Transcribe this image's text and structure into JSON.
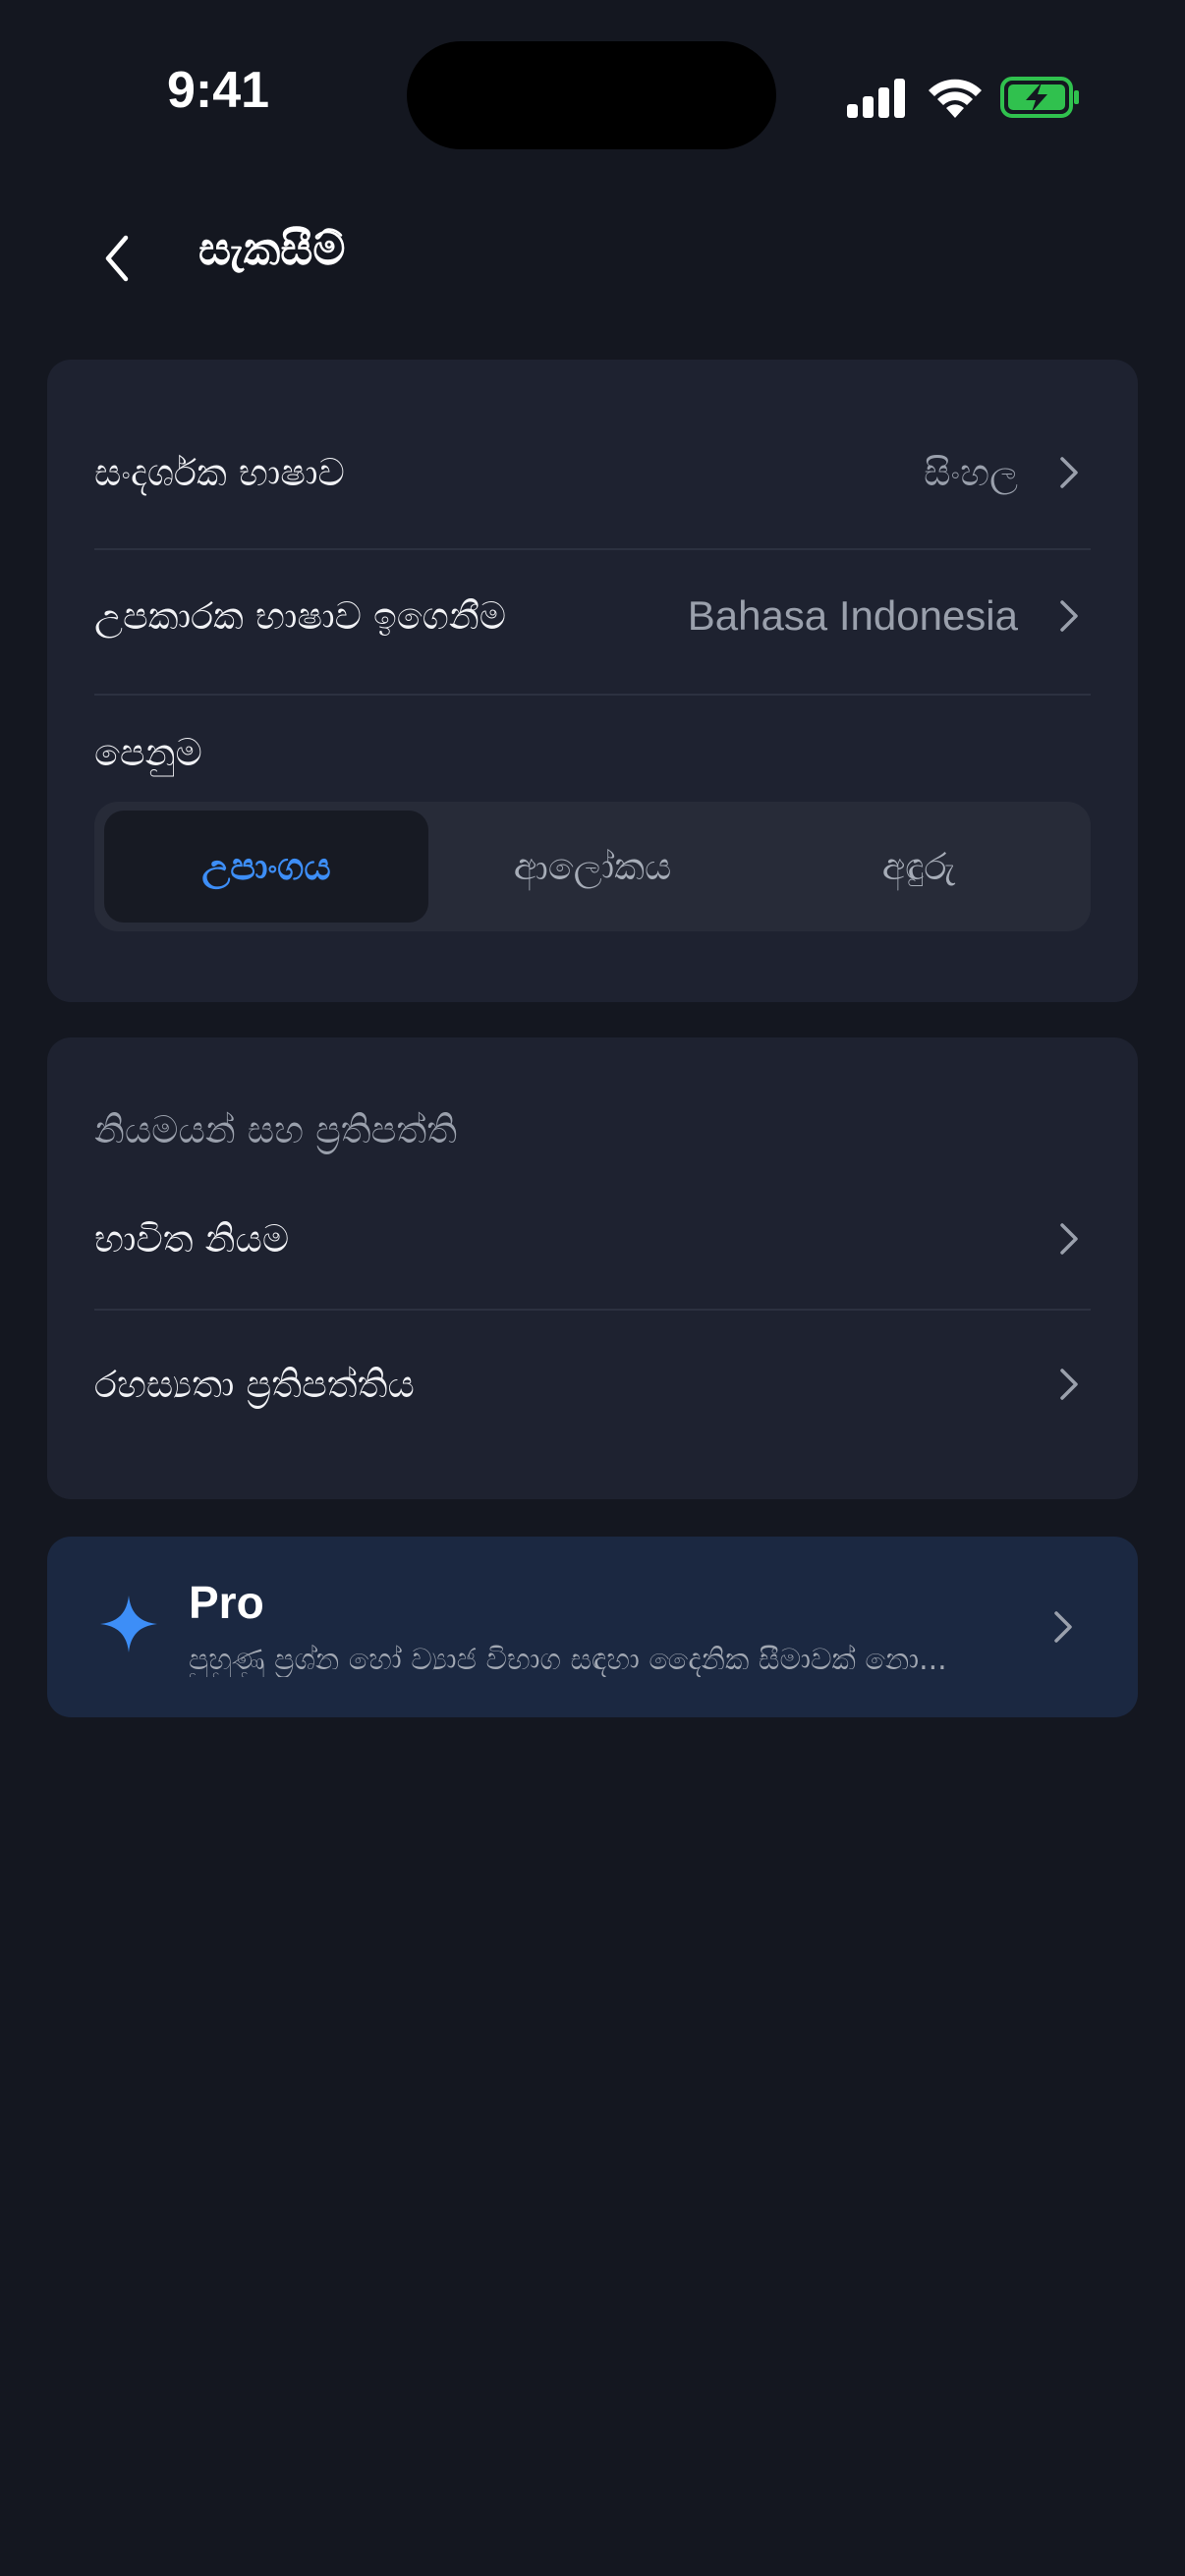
{
  "status_bar": {
    "time": "9:41",
    "icons": [
      "cellular-signal-icon",
      "wifi-icon",
      "battery-charging-icon"
    ],
    "battery_color": "#30c14e"
  },
  "header": {
    "title": "සැකසීම්",
    "back_icon": "chevron-left-icon"
  },
  "settings": {
    "display_language": {
      "label": "සංදර්ශක භාෂාව",
      "value": "සිංහල"
    },
    "learning_language": {
      "label": "උපකාරක භාෂාව ඉගෙනීම",
      "value": "Bahasa Indonesia"
    },
    "appearance": {
      "label": "පෙනුම",
      "options": [
        "උපාංගය",
        "ආලෝකය",
        "අඳුරු"
      ],
      "selected": "උපාංගය"
    }
  },
  "policies": {
    "section_title": "නියමයන් සහ ප්‍රතිපත්ති",
    "terms": {
      "label": "භාවිත නියම"
    },
    "privacy": {
      "label": "රහස්‍යතා ප්‍රතිපත්තිය"
    }
  },
  "pro": {
    "icon": "sparkle-icon",
    "title": "Pro",
    "subtitle": "පුහුණු ප්‍රශ්න හෝ ව්‍යාජ විභාග සඳහා දෛනික සීමාවක් නො...",
    "accent": "#3d8ef7"
  },
  "colors": {
    "background": "#141720",
    "card": "#1e2230",
    "pro_card": "#1b2841",
    "accent": "#3d8ef7"
  }
}
